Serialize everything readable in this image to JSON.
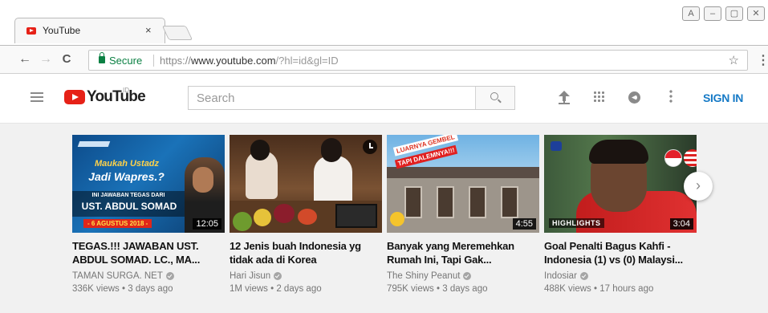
{
  "browser": {
    "tab_title": "YouTube",
    "tab_close": "×",
    "secure_label": "Secure",
    "url_scheme": "https://",
    "url_host": "www.youtube.com",
    "url_rest": "/?hl=id&gl=ID",
    "back": "←",
    "forward": "→",
    "reload": "C",
    "star": "☆",
    "menu": "⋮",
    "window_controls": [
      "A",
      "–",
      "▢",
      "✕"
    ]
  },
  "header": {
    "logo_text": "YouTube",
    "country_code": "ID",
    "search_placeholder": "Search",
    "sign_in": "SIGN IN"
  },
  "videos": [
    {
      "title": "TEGAS.!!! JAWABAN UST. ABDUL SOMAD. LC., MA...",
      "channel": "TAMAN SURGA. NET",
      "meta": "336K views • 3 days ago",
      "duration": "12:05",
      "thumb_text": {
        "line1": "Maukah Ustadz",
        "line2": "Jadi Wapres.?",
        "line3": "INI JAWABAN TEGAS DARI",
        "line4": "UST. ABDUL SOMAD",
        "date": "- 6 AGUSTUS 2018 -"
      }
    },
    {
      "title": "12 Jenis buah Indonesia yg tidak ada di Korea",
      "channel": "Hari Jisun",
      "meta": "1M views • 2 days ago",
      "duration": ""
    },
    {
      "title": "Banyak yang Meremehkan Rumah Ini, Tapi Gak...",
      "channel": "The Shiny Peanut",
      "meta": "795K views • 3 days ago",
      "duration": "4:55",
      "thumb_text": {
        "line1": "LUARNYA GEMBEL",
        "line2": "TAPI DALEMNYA!!!"
      }
    },
    {
      "title": "Goal Penalti Bagus Kahfi - Indonesia (1) vs (0) Malaysi...",
      "channel": "Indosiar",
      "meta": "488K views • 17 hours ago",
      "duration": "3:04",
      "thumb_text": {
        "badge": "HIGHLIGHTS"
      }
    }
  ],
  "next_arrow": "›",
  "colors": {
    "accent": "#e62117",
    "sign_in": "#167ac6",
    "secure": "#0b8043"
  }
}
